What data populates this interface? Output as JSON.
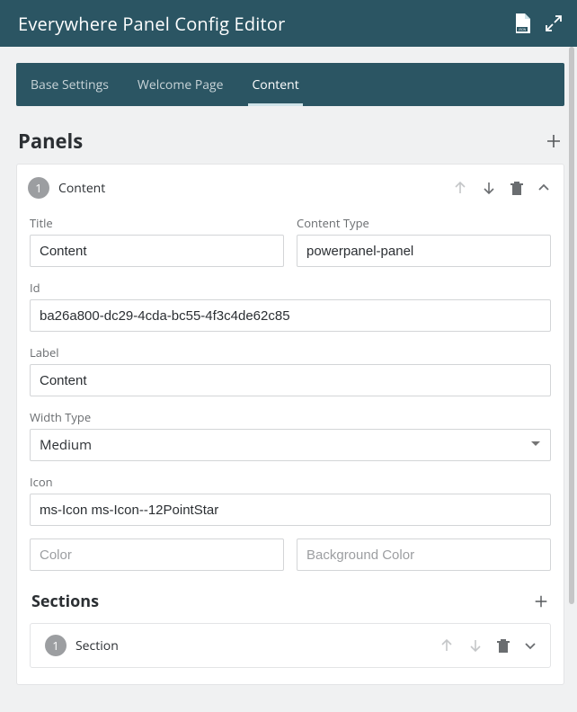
{
  "header": {
    "title": "Everywhere Panel Config Editor"
  },
  "tabs": [
    {
      "label": "Base Settings",
      "active": false
    },
    {
      "label": "Welcome Page",
      "active": false
    },
    {
      "label": "Content",
      "active": true
    }
  ],
  "panels": {
    "heading": "Panels",
    "item": {
      "index": "1",
      "name": "Content",
      "fields": {
        "title_label": "Title",
        "title_value": "Content",
        "content_type_label": "Content Type",
        "content_type_value": "powerpanel-panel",
        "id_label": "Id",
        "id_value": "ba26a800-dc29-4cda-bc55-4f3c4de62c85",
        "label_label": "Label",
        "label_value": "Content",
        "width_type_label": "Width Type",
        "width_type_value": "Medium",
        "icon_label": "Icon",
        "icon_value": "ms-Icon ms-Icon--12PointStar",
        "color_placeholder": "Color",
        "bg_color_placeholder": "Background Color"
      },
      "sections": {
        "heading": "Sections",
        "item": {
          "index": "1",
          "name": "Section"
        }
      }
    }
  }
}
